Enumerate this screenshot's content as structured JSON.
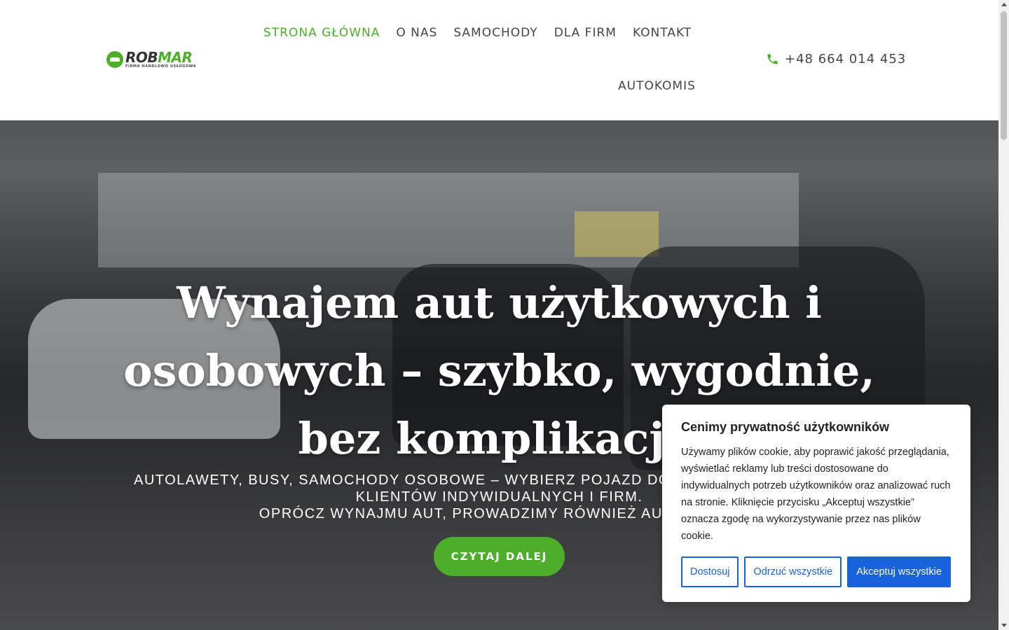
{
  "logo": {
    "word_a": "ROB",
    "word_b": "MAR",
    "subtitle": "FIRMA HANDLOWO USŁUGOWA"
  },
  "nav": {
    "items": [
      {
        "label": "STRONA GŁÓWNA",
        "active": true
      },
      {
        "label": "O NAS"
      },
      {
        "label": "SAMOCHODY"
      },
      {
        "label": "DLA FIRM"
      },
      {
        "label": "KONTAKT"
      }
    ],
    "second_row": "AUTOKOMIS"
  },
  "phone": {
    "number": "+48 664 014 453",
    "icon": "phone-icon"
  },
  "hero": {
    "title_line1": "Wynajem aut użytkowych i",
    "title_line2": "osobowych – szybko, wygodnie,",
    "title_line3": "bez komplikacji!",
    "sub_line1": "Autolawety, busy, samochody osobowe – wybierz pojazd dopasowany do potrzeb",
    "sub_line2": "klientów indywidualnych i firm.",
    "sub_line3": "Oprócz wynajmu aut, prowadzimy również autokomis.",
    "button": "CZYTAJ DALEJ"
  },
  "cookie": {
    "title": "Cenimy prywatność użytkowników",
    "text": "Używamy plików cookie, aby poprawić jakość przeglądania, wyświetlać reklamy lub treści dostosowane do indywidualnych potrzeb użytkowników oraz analizować ruch na stronie. Kliknięcie przycisku „Akceptuj wszystkie” oznacza zgodę na wykorzystywanie przez nas plików cookie.",
    "btn_customize": "Dostosuj",
    "btn_reject": "Odrzuć wszystkie",
    "btn_accept": "Akceptuj wszystkie"
  },
  "colors": {
    "brand_green": "#4cae2a",
    "cookie_blue": "#1863dc"
  }
}
